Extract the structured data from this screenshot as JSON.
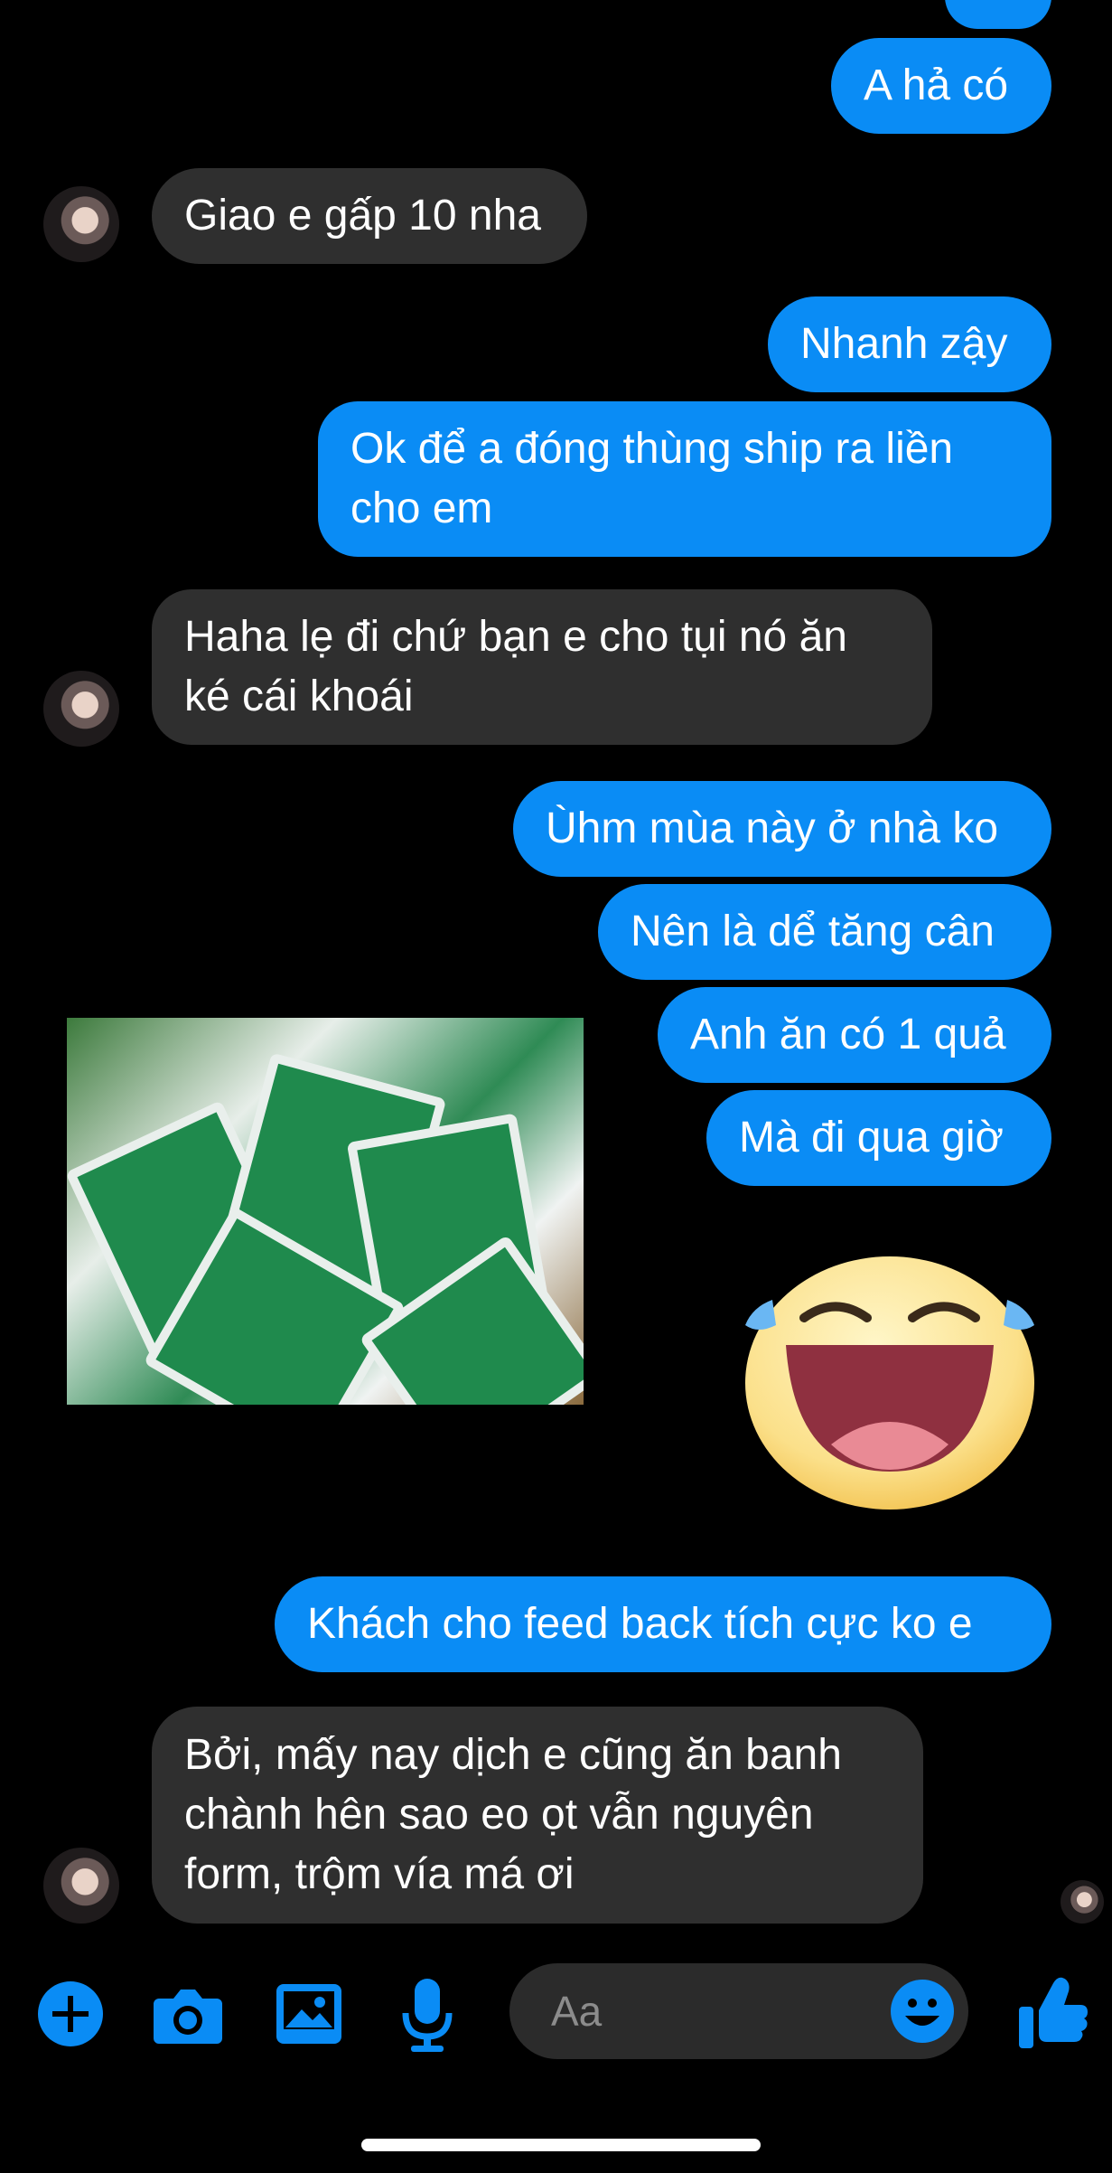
{
  "colors": {
    "accent": "#0a8cf5",
    "incoming_bubble": "#2f2f2f",
    "background": "#000000"
  },
  "messages": [
    {
      "from": "me",
      "text": ""
    },
    {
      "from": "me",
      "text": "A hả có"
    },
    {
      "from": "them",
      "text": "Giao e gấp 10 nha"
    },
    {
      "from": "me",
      "text": "Nhanh zậy"
    },
    {
      "from": "me",
      "lines": [
        "Ok để a  đóng thùng ship ra liền",
        "cho em"
      ]
    },
    {
      "from": "them",
      "lines": [
        "Haha lẹ đi chứ bạn e cho tụi nó ăn",
        "ké cái khoái"
      ]
    },
    {
      "from": "me",
      "text": "Ùhm mùa này ở nhà ko"
    },
    {
      "from": "me",
      "text": "Nên là dể tăng cân"
    },
    {
      "from": "me",
      "text": "Anh ăn có 1 quả"
    },
    {
      "from": "me",
      "text": "Mà đi qua giờ"
    },
    {
      "from": "them",
      "type": "photo"
    },
    {
      "from": "me",
      "type": "emoji",
      "emoji": "laughing-tears"
    },
    {
      "from": "me",
      "text": "Khách cho feed back tích cực ko e"
    },
    {
      "from": "them",
      "lines": [
        "Bởi, mấy nay dịch e cũng ăn banh",
        "chành hên sao eo ọt vẫn nguyên",
        "form, trộm vía má ơi"
      ]
    }
  ],
  "composer": {
    "placeholder": "Aa",
    "icons": [
      "plus-icon",
      "camera-icon",
      "image-icon",
      "microphone-icon",
      "emoji-icon",
      "thumbs-up-icon"
    ]
  }
}
